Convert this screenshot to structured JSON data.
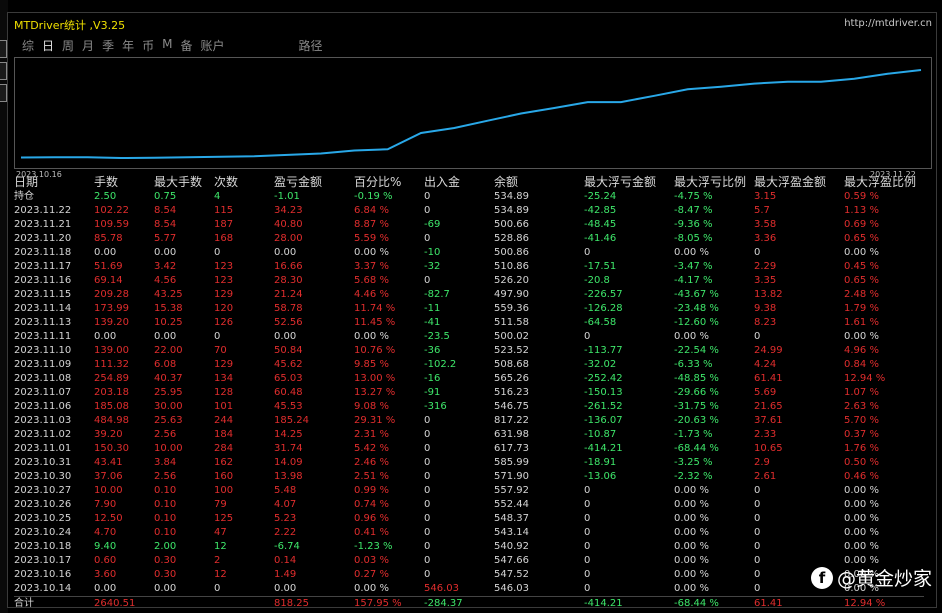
{
  "window": {
    "title": "MTDriver统计 ,V3.25",
    "url": "http://mtdriver.cn"
  },
  "tabs": [
    {
      "label": "综",
      "active": false
    },
    {
      "label": "日",
      "active": true
    },
    {
      "label": "周",
      "active": false
    },
    {
      "label": "月",
      "active": false
    },
    {
      "label": "季",
      "active": false
    },
    {
      "label": "年",
      "active": false
    },
    {
      "label": "币",
      "active": false
    },
    {
      "label": "M",
      "active": false
    },
    {
      "label": "备",
      "active": false
    },
    {
      "label": "账户",
      "active": false
    },
    {
      "label": "路径",
      "active": false
    }
  ],
  "chart_data": {
    "type": "line",
    "x_start_label": "2023.10.16",
    "x_end_label": "2023.11.22",
    "line_color": "#29a8e8",
    "x": [
      "2023.10.14",
      "2023.10.16",
      "2023.10.17",
      "2023.10.18",
      "2023.10.24",
      "2023.10.25",
      "2023.10.26",
      "2023.10.27",
      "2023.10.30",
      "2023.10.31",
      "2023.11.01",
      "2023.11.02",
      "2023.11.03",
      "2023.11.06",
      "2023.11.07",
      "2023.11.08",
      "2023.11.09",
      "2023.11.10",
      "2023.11.11",
      "2023.11.13",
      "2023.11.14",
      "2023.11.15",
      "2023.11.16",
      "2023.11.17",
      "2023.11.18",
      "2023.11.20",
      "2023.11.21",
      "2023.11.22"
    ],
    "values": [
      546.03,
      547.52,
      547.66,
      540.92,
      543.14,
      548.37,
      552.44,
      557.92,
      571.9,
      585.99,
      617.73,
      631.98,
      817.22,
      546.75,
      516.23,
      565.26,
      508.68,
      523.52,
      500.02,
      511.58,
      559.36,
      497.9,
      526.2,
      510.86,
      500.86,
      528.86,
      500.66,
      534.89
    ],
    "cumulative_pct": [
      0,
      0.27,
      0.3,
      -0.93,
      -0.52,
      0.44,
      1.18,
      2.17,
      4.68,
      7.14,
      12.56,
      14.87,
      44.18,
      53.26,
      66.53,
      79.53,
      89.38,
      100.14,
      100.14,
      111.59,
      123.33,
      127.79,
      133.47,
      136.84,
      136.84,
      142.43,
      151.3,
      158.14
    ]
  },
  "table": {
    "headers": [
      "日期",
      "手数",
      "最大手数",
      "次数",
      "盈亏金额",
      "百分比%",
      "出入金",
      "余额",
      "最大浮亏金额",
      "最大浮亏比例",
      "最大浮盈金额",
      "最大浮盈比例"
    ],
    "rows": [
      {
        "c": [
          "持仓",
          "2.50",
          "0.75",
          "4",
          "-1.01",
          "-0.19 %",
          "0",
          "534.89",
          "-25.24",
          "-4.75 %",
          "3.15",
          "0.59 %"
        ],
        "k": [
          "white",
          "green",
          "green",
          "green",
          "green",
          "green",
          "white",
          "white",
          "green",
          "green",
          "red",
          "red"
        ]
      },
      {
        "c": [
          "2023.11.22",
          "102.22",
          "8.54",
          "115",
          "34.23",
          "6.84 %",
          "0",
          "534.89",
          "-42.85",
          "-8.47 %",
          "5.7",
          "1.13 %"
        ],
        "k": [
          "white",
          "red",
          "red",
          "red",
          "red",
          "red",
          "white",
          "white",
          "green",
          "green",
          "red",
          "red"
        ]
      },
      {
        "c": [
          "2023.11.21",
          "109.59",
          "8.54",
          "187",
          "40.80",
          "8.87 %",
          "-69",
          "500.66",
          "-48.45",
          "-9.36 %",
          "3.58",
          "0.69 %"
        ],
        "k": [
          "white",
          "red",
          "red",
          "red",
          "red",
          "red",
          "green",
          "white",
          "green",
          "green",
          "red",
          "red"
        ]
      },
      {
        "c": [
          "2023.11.20",
          "85.78",
          "5.77",
          "168",
          "28.00",
          "5.59 %",
          "0",
          "528.86",
          "-41.46",
          "-8.05 %",
          "3.36",
          "0.65 %"
        ],
        "k": [
          "white",
          "red",
          "red",
          "red",
          "red",
          "red",
          "white",
          "white",
          "green",
          "green",
          "red",
          "red"
        ]
      },
      {
        "c": [
          "2023.11.18",
          "0.00",
          "0.00",
          "0",
          "0.00",
          "0.00 %",
          "-10",
          "500.86",
          "0",
          "0.00 %",
          "0",
          "0.00 %"
        ],
        "k": [
          "white",
          "white",
          "white",
          "white",
          "white",
          "white",
          "green",
          "white",
          "white",
          "white",
          "white",
          "white"
        ]
      },
      {
        "c": [
          "2023.11.17",
          "51.69",
          "3.42",
          "123",
          "16.66",
          "3.37 %",
          "-32",
          "510.86",
          "-17.51",
          "-3.47 %",
          "2.29",
          "0.45 %"
        ],
        "k": [
          "white",
          "red",
          "red",
          "red",
          "red",
          "red",
          "green",
          "white",
          "green",
          "green",
          "red",
          "red"
        ]
      },
      {
        "c": [
          "2023.11.16",
          "69.14",
          "4.56",
          "123",
          "28.30",
          "5.68 %",
          "0",
          "526.20",
          "-20.8",
          "-4.17 %",
          "3.35",
          "0.65 %"
        ],
        "k": [
          "white",
          "red",
          "red",
          "red",
          "red",
          "red",
          "white",
          "white",
          "green",
          "green",
          "red",
          "red"
        ]
      },
      {
        "c": [
          "2023.11.15",
          "209.28",
          "43.25",
          "129",
          "21.24",
          "4.46 %",
          "-82.7",
          "497.90",
          "-226.57",
          "-43.67 %",
          "13.82",
          "2.48 %"
        ],
        "k": [
          "white",
          "red",
          "red",
          "red",
          "red",
          "red",
          "green",
          "white",
          "green",
          "green",
          "red",
          "red"
        ]
      },
      {
        "c": [
          "2023.11.14",
          "173.99",
          "15.38",
          "120",
          "58.78",
          "11.74 %",
          "-11",
          "559.36",
          "-126.28",
          "-23.48 %",
          "9.38",
          "1.79 %"
        ],
        "k": [
          "white",
          "red",
          "red",
          "red",
          "red",
          "red",
          "green",
          "white",
          "green",
          "green",
          "red",
          "red"
        ]
      },
      {
        "c": [
          "2023.11.13",
          "139.20",
          "10.25",
          "126",
          "52.56",
          "11.45 %",
          "-41",
          "511.58",
          "-64.58",
          "-12.60 %",
          "8.23",
          "1.61 %"
        ],
        "k": [
          "white",
          "red",
          "red",
          "red",
          "red",
          "red",
          "green",
          "white",
          "green",
          "green",
          "red",
          "red"
        ]
      },
      {
        "c": [
          "2023.11.11",
          "0.00",
          "0.00",
          "0",
          "0.00",
          "0.00 %",
          "-23.5",
          "500.02",
          "0",
          "0.00 %",
          "0",
          "0.00 %"
        ],
        "k": [
          "white",
          "white",
          "white",
          "white",
          "white",
          "white",
          "green",
          "white",
          "white",
          "white",
          "white",
          "white"
        ]
      },
      {
        "c": [
          "2023.11.10",
          "139.00",
          "22.00",
          "70",
          "50.84",
          "10.76 %",
          "-36",
          "523.52",
          "-113.77",
          "-22.54 %",
          "24.99",
          "4.96 %"
        ],
        "k": [
          "white",
          "red",
          "red",
          "red",
          "red",
          "red",
          "green",
          "white",
          "green",
          "green",
          "red",
          "red"
        ]
      },
      {
        "c": [
          "2023.11.09",
          "111.32",
          "6.08",
          "129",
          "45.62",
          "9.85 %",
          "-102.2",
          "508.68",
          "-32.02",
          "-6.33 %",
          "4.24",
          "0.84 %"
        ],
        "k": [
          "white",
          "red",
          "red",
          "red",
          "red",
          "red",
          "green",
          "white",
          "green",
          "green",
          "red",
          "red"
        ]
      },
      {
        "c": [
          "2023.11.08",
          "254.89",
          "40.37",
          "134",
          "65.03",
          "13.00 %",
          "-16",
          "565.26",
          "-252.42",
          "-48.85 %",
          "61.41",
          "12.94 %"
        ],
        "k": [
          "white",
          "red",
          "red",
          "red",
          "red",
          "red",
          "green",
          "white",
          "green",
          "green",
          "red",
          "red"
        ]
      },
      {
        "c": [
          "2023.11.07",
          "203.18",
          "25.95",
          "128",
          "60.48",
          "13.27 %",
          "-91",
          "516.23",
          "-150.13",
          "-29.66 %",
          "5.69",
          "1.07 %"
        ],
        "k": [
          "white",
          "red",
          "red",
          "red",
          "red",
          "red",
          "green",
          "white",
          "green",
          "green",
          "red",
          "red"
        ]
      },
      {
        "c": [
          "2023.11.06",
          "185.08",
          "30.00",
          "101",
          "45.53",
          "9.08 %",
          "-316",
          "546.75",
          "-261.52",
          "-31.75 %",
          "21.65",
          "2.63 %"
        ],
        "k": [
          "white",
          "red",
          "red",
          "red",
          "red",
          "red",
          "green",
          "white",
          "green",
          "green",
          "red",
          "red"
        ]
      },
      {
        "c": [
          "2023.11.03",
          "484.98",
          "25.63",
          "244",
          "185.24",
          "29.31 %",
          "0",
          "817.22",
          "-136.07",
          "-20.63 %",
          "37.61",
          "5.70 %"
        ],
        "k": [
          "white",
          "red",
          "red",
          "red",
          "red",
          "red",
          "white",
          "white",
          "green",
          "green",
          "red",
          "red"
        ]
      },
      {
        "c": [
          "2023.11.02",
          "39.20",
          "2.56",
          "184",
          "14.25",
          "2.31 %",
          "0",
          "631.98",
          "-10.87",
          "-1.73 %",
          "2.33",
          "0.37 %"
        ],
        "k": [
          "white",
          "red",
          "red",
          "red",
          "red",
          "red",
          "white",
          "white",
          "green",
          "green",
          "red",
          "red"
        ]
      },
      {
        "c": [
          "2023.11.01",
          "150.30",
          "10.00",
          "284",
          "31.74",
          "5.42 %",
          "0",
          "617.73",
          "-414.21",
          "-68.44 %",
          "10.65",
          "1.76 %"
        ],
        "k": [
          "white",
          "red",
          "red",
          "red",
          "red",
          "red",
          "white",
          "white",
          "green",
          "green",
          "red",
          "red"
        ]
      },
      {
        "c": [
          "2023.10.31",
          "43.41",
          "3.84",
          "162",
          "14.09",
          "2.46 %",
          "0",
          "585.99",
          "-18.91",
          "-3.25 %",
          "2.9",
          "0.50 %"
        ],
        "k": [
          "white",
          "red",
          "red",
          "red",
          "red",
          "red",
          "white",
          "white",
          "green",
          "green",
          "red",
          "red"
        ]
      },
      {
        "c": [
          "2023.10.30",
          "37.06",
          "2.56",
          "160",
          "13.98",
          "2.51 %",
          "0",
          "571.90",
          "-13.06",
          "-2.32 %",
          "2.61",
          "0.46 %"
        ],
        "k": [
          "white",
          "red",
          "red",
          "red",
          "red",
          "red",
          "white",
          "white",
          "green",
          "green",
          "red",
          "red"
        ]
      },
      {
        "c": [
          "2023.10.27",
          "10.00",
          "0.10",
          "100",
          "5.48",
          "0.99 %",
          "0",
          "557.92",
          "0",
          "0.00 %",
          "0",
          "0.00 %"
        ],
        "k": [
          "white",
          "red",
          "red",
          "red",
          "red",
          "red",
          "white",
          "white",
          "white",
          "white",
          "white",
          "white"
        ]
      },
      {
        "c": [
          "2023.10.26",
          "7.90",
          "0.10",
          "79",
          "4.07",
          "0.74 %",
          "0",
          "552.44",
          "0",
          "0.00 %",
          "0",
          "0.00 %"
        ],
        "k": [
          "white",
          "red",
          "red",
          "red",
          "red",
          "red",
          "white",
          "white",
          "white",
          "white",
          "white",
          "white"
        ]
      },
      {
        "c": [
          "2023.10.25",
          "12.50",
          "0.10",
          "125",
          "5.23",
          "0.96 %",
          "0",
          "548.37",
          "0",
          "0.00 %",
          "0",
          "0.00 %"
        ],
        "k": [
          "white",
          "red",
          "red",
          "red",
          "red",
          "red",
          "white",
          "white",
          "white",
          "white",
          "white",
          "white"
        ]
      },
      {
        "c": [
          "2023.10.24",
          "4.70",
          "0.10",
          "47",
          "2.22",
          "0.41 %",
          "0",
          "543.14",
          "0",
          "0.00 %",
          "0",
          "0.00 %"
        ],
        "k": [
          "white",
          "red",
          "red",
          "red",
          "red",
          "red",
          "white",
          "white",
          "white",
          "white",
          "white",
          "white"
        ]
      },
      {
        "c": [
          "2023.10.18",
          "9.40",
          "2.00",
          "12",
          "-6.74",
          "-1.23 %",
          "0",
          "540.92",
          "0",
          "0.00 %",
          "0",
          "0.00 %"
        ],
        "k": [
          "white",
          "green",
          "green",
          "green",
          "green",
          "green",
          "white",
          "white",
          "white",
          "white",
          "white",
          "white"
        ]
      },
      {
        "c": [
          "2023.10.17",
          "0.60",
          "0.30",
          "2",
          "0.14",
          "0.03 %",
          "0",
          "547.66",
          "0",
          "0.00 %",
          "0",
          "0.00 %"
        ],
        "k": [
          "white",
          "red",
          "red",
          "red",
          "red",
          "red",
          "white",
          "white",
          "white",
          "white",
          "white",
          "white"
        ]
      },
      {
        "c": [
          "2023.10.16",
          "3.60",
          "0.30",
          "12",
          "1.49",
          "0.27 %",
          "0",
          "547.52",
          "0",
          "0.00 %",
          "0",
          "0.00 %"
        ],
        "k": [
          "white",
          "red",
          "red",
          "red",
          "red",
          "red",
          "white",
          "white",
          "white",
          "white",
          "white",
          "white"
        ]
      },
      {
        "c": [
          "2023.10.14",
          "0.00",
          "0.00",
          "0",
          "0.00",
          "0.00 %",
          "546.03",
          "546.03",
          "0",
          "0.00 %",
          "0",
          "0.00 %"
        ],
        "k": [
          "white",
          "white",
          "white",
          "white",
          "white",
          "white",
          "red",
          "white",
          "white",
          "white",
          "white",
          "white"
        ]
      }
    ],
    "total": {
      "c": [
        "合计",
        "2640.51",
        "",
        "",
        "818.25",
        "157.95 %",
        "-284.37",
        "",
        "-414.21",
        "-68.44 %",
        "61.41",
        "12.94 %"
      ],
      "k": [
        "white",
        "red",
        "white",
        "white",
        "red",
        "red",
        "green",
        "white",
        "green",
        "green",
        "red",
        "red"
      ]
    }
  },
  "watermark": {
    "text": "@黄金炒家",
    "icon": "facebook-icon"
  }
}
